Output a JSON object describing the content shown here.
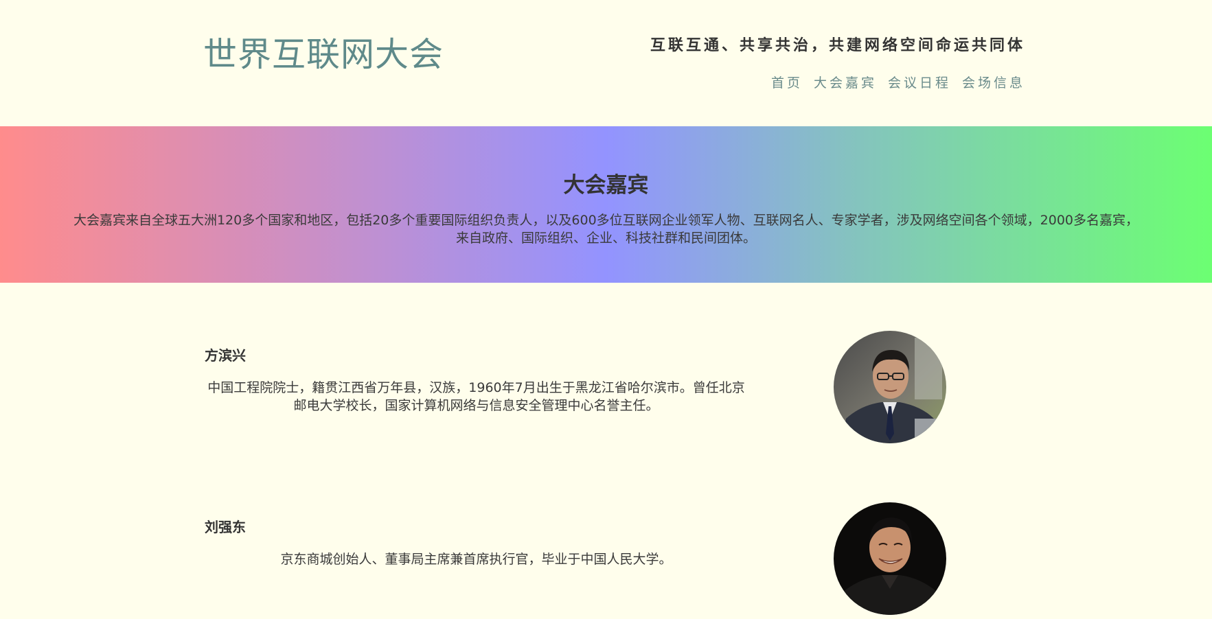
{
  "header": {
    "site_title": "世界互联网大会",
    "slogan": "互联互通、共享共治，共建网络空间命运共同体",
    "nav": [
      {
        "label": "首页"
      },
      {
        "label": "大会嘉宾"
      },
      {
        "label": "会议日程"
      },
      {
        "label": "会场信息"
      }
    ]
  },
  "banner": {
    "title": "大会嘉宾",
    "text": "大会嘉宾来自全球五大洲120多个国家和地区，包括20多个重要国际组织负责人，以及600多位互联网企业领军人物、互联网名人、专家学者，涉及网络空间各个领域，2000多名嘉宾，来自政府、国际组织、企业、科技社群和民间团体。"
  },
  "guests": [
    {
      "name": "方滨兴",
      "bio": "中国工程院院士，籍贯江西省万年县，汉族，1960年7月出生于黑龙江省哈尔滨市。曾任北京邮电大学校长，国家计算机网络与信息安全管理中心名誉主任。"
    },
    {
      "name": "刘强东",
      "bio": "京东商城创始人、董事局主席兼首席执行官，毕业于中国人民大学。"
    }
  ],
  "colors": {
    "background": "#fffeec",
    "title": "#5f8a8a",
    "nav": "#6a8b8b",
    "gradient": [
      "#ff8c8c",
      "#cc8fc4",
      "#9393ff",
      "#85c2c0",
      "#6cff72"
    ]
  }
}
